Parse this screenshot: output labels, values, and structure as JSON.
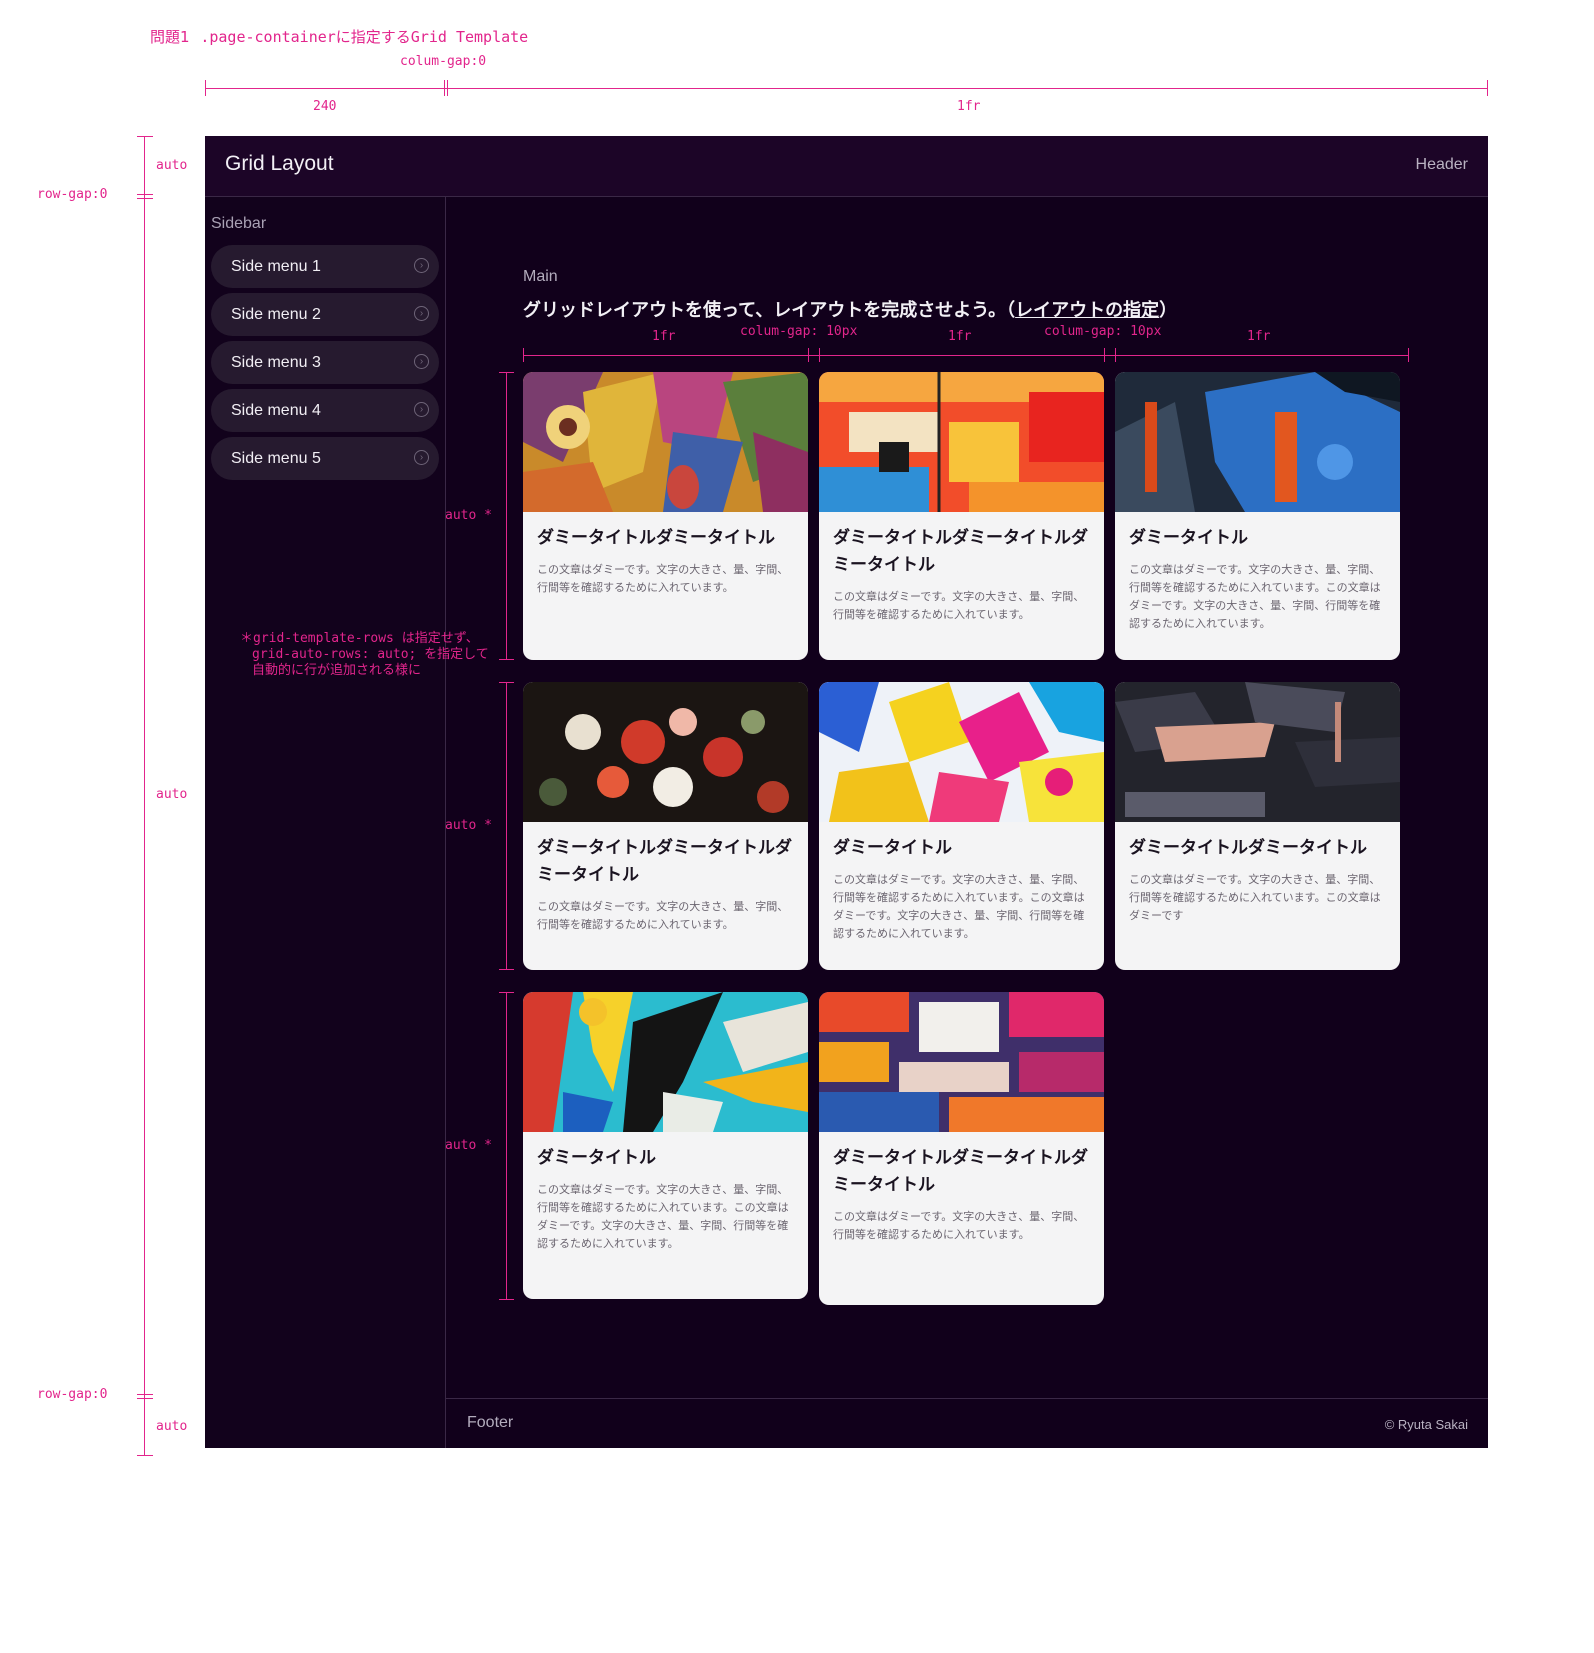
{
  "annotations": {
    "heading_prefix": "問題1",
    "heading_rest": ".page-containerに指定するGrid Template",
    "col_gap_top": "colum-gap:0",
    "col_240": "240",
    "col_1fr": "1fr",
    "row_auto_top": "auto",
    "row_gap_1": "row-gap:0",
    "row_auto_mid": "auto",
    "row_gap_2": "row-gap:0",
    "row_auto_bottom": "auto",
    "inner_1fr_a": "1fr",
    "inner_gap_a": "colum-gap: 10px",
    "inner_1fr_b": "1fr",
    "inner_gap_b": "colum-gap: 10px",
    "inner_1fr_c": "1fr",
    "card_row_auto_1": "auto *",
    "card_row_auto_2": "auto *",
    "card_row_auto_3": "auto *",
    "note_line1": "＊grid-template-rows は指定せず、",
    "note_line2": "grid-auto-rows: auto; を指定して",
    "note_line3": "自動的に行が追加される様に"
  },
  "header": {
    "title": "Grid Layout",
    "label": "Header"
  },
  "sidebar": {
    "label": "Sidebar",
    "items": [
      {
        "label": "Side menu 1"
      },
      {
        "label": "Side menu 2"
      },
      {
        "label": "Side menu 3"
      },
      {
        "label": "Side menu 4"
      },
      {
        "label": "Side menu 5"
      }
    ]
  },
  "main": {
    "label": "Main",
    "heading": "グリッドレイアウトを使って、レイアウトを完成させよう。（",
    "heading_link": "レイアウトの指定",
    "heading_end": "）"
  },
  "cards": [
    {
      "title": "ダミータイトルダミータイトル",
      "text": "この文章はダミーです。文字の大きさ、量、字間、行間等を確認するために入れています。"
    },
    {
      "title": "ダミータイトルダミータイトルダミータイトル",
      "text": "この文章はダミーです。文字の大きさ、量、字間、行間等を確認するために入れています。"
    },
    {
      "title": "ダミータイトル",
      "text": "この文章はダミーです。文字の大きさ、量、字間、行間等を確認するために入れています。この文章はダミーです。文字の大きさ、量、字間、行間等を確認するために入れています。"
    },
    {
      "title": "ダミータイトルダミータイトルダミータイトル",
      "text": "この文章はダミーです。文字の大きさ、量、字間、行間等を確認するために入れています。"
    },
    {
      "title": "ダミータイトル",
      "text": "この文章はダミーです。文字の大きさ、量、字間、行間等を確認するために入れています。この文章はダミーです。文字の大きさ、量、字間、行間等を確認するために入れています。"
    },
    {
      "title": "ダミータイトルダミータイトル",
      "text": "この文章はダミーです。文字の大きさ、量、字間、行間等を確認するために入れています。この文章はダミーです"
    },
    {
      "title": "ダミータイトル",
      "text": "この文章はダミーです。文字の大きさ、量、字間、行間等を確認するために入れています。この文章はダミーです。文字の大きさ、量、字間、行間等を確認するために入れています。"
    },
    {
      "title": "ダミータイトルダミータイトルダミータイトル",
      "text": "この文章はダミーです。文字の大きさ、量、字間、行間等を確認するために入れています。"
    }
  ],
  "footer": {
    "label": "Footer",
    "copyright": "© Ryuta Sakai"
  },
  "colors": {
    "annotation": "#e2258c",
    "page_bg": "#11001b",
    "header_bg": "#1c0527",
    "menu_bg": "#261a2f",
    "card_bg": "#f4f4f5"
  }
}
